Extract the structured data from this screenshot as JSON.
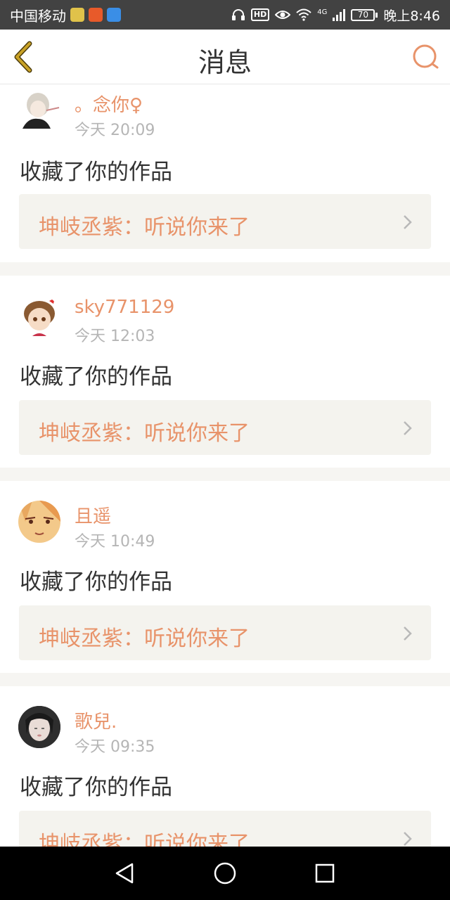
{
  "status_bar": {
    "carrier": "中国移动",
    "network": "4G",
    "battery": "70",
    "time": "晚上8:46"
  },
  "header": {
    "title": "消息"
  },
  "messages": [
    {
      "username": "。念你♀",
      "time": "今天 20:09",
      "action": "收藏了你的作品",
      "work": "坤岐丞紫：听说你来了"
    },
    {
      "username": "sky771129",
      "time": "今天 12:03",
      "action": "收藏了你的作品",
      "work": "坤岐丞紫：听说你来了"
    },
    {
      "username": "且遥",
      "time": "今天 10:49",
      "action": "收藏了你的作品",
      "work": "坤岐丞紫：听说你来了"
    },
    {
      "username": "歌兒.",
      "time": "今天 09:35",
      "action": "收藏了你的作品",
      "work": "坤岐丞紫：听说你来了"
    }
  ],
  "colors": {
    "accent": "#e8936a",
    "back_icon": "#c9a227",
    "status_bar_bg": "#424242",
    "work_box_bg": "#f4f3ee"
  }
}
